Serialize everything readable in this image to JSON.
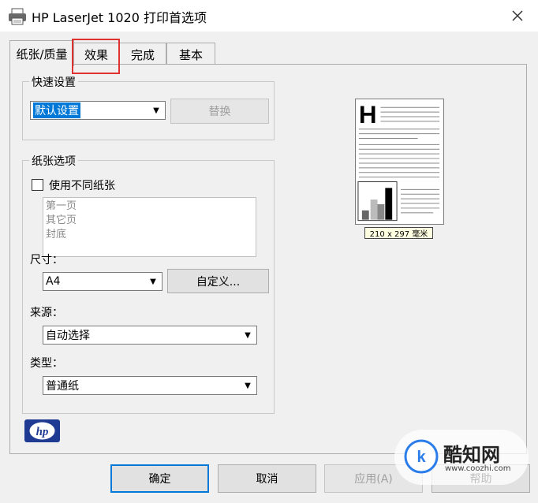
{
  "window": {
    "title": "HP LaserJet 1020 打印首选项"
  },
  "tabs": [
    {
      "label": "纸张/质量"
    },
    {
      "label": "效果"
    },
    {
      "label": "完成"
    },
    {
      "label": "基本"
    }
  ],
  "quick_settings": {
    "label": "快速设置",
    "value": "默认设置",
    "replace_button": "替换"
  },
  "paper_options": {
    "label": "纸张选项",
    "use_different_paper": "使用不同纸张",
    "pages": [
      "第一页",
      "其它页",
      "封底"
    ],
    "size_label": "尺寸：",
    "size_value": "A4",
    "custom_button": "自定义...",
    "source_label": "来源：",
    "source_value": "自动选择",
    "type_label": "类型：",
    "type_value": "普通纸"
  },
  "preview": {
    "size_text": "210 x 297 毫米"
  },
  "logo": {
    "text": "hp"
  },
  "buttons": {
    "ok": "确定",
    "cancel": "取消",
    "apply": "应用(A)",
    "help": "帮助"
  },
  "watermark": {
    "text": "酷知网",
    "url": "www.coozhi.com"
  },
  "colors": {
    "highlight": "#e03131",
    "accent": "#0078d7",
    "hp_blue": "#1f3a93"
  }
}
